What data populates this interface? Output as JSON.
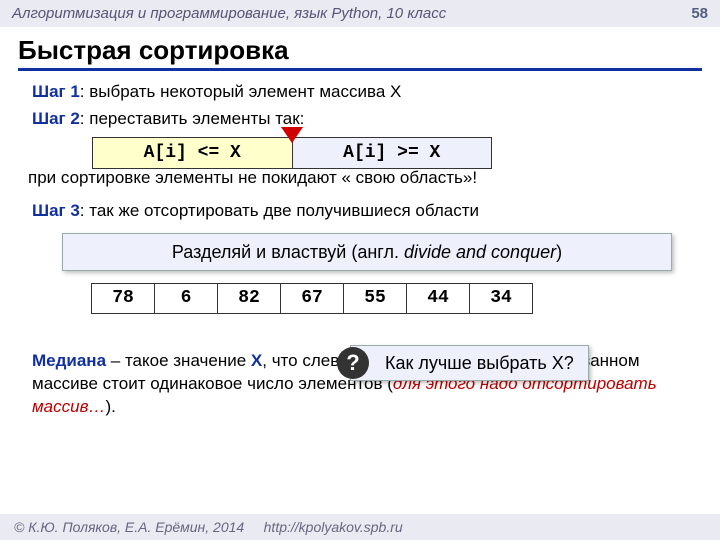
{
  "header": {
    "course": "Алгоритмизация и программирование, язык Python, 10 класс",
    "page": "58"
  },
  "title": "Быстрая сортировка",
  "step1": {
    "label": "Шаг 1",
    "text": ": выбрать некоторый элемент массива X"
  },
  "step2": {
    "label": "Шаг 2",
    "text": ": переставить элементы так:"
  },
  "split": {
    "left": "A[i] <= X",
    "right": "A[i] >= X"
  },
  "note_after_split": "при сортировке элементы не покидают « свою область»!",
  "step3": {
    "label": "Шаг 3",
    "text": ": так же отсортировать две получившиеся области"
  },
  "callout": {
    "ru": "Разделяй и властвуй (англ. ",
    "en": "divide and conquer",
    "tail": ")"
  },
  "array": [
    "78",
    "6",
    "82",
    "67",
    "55",
    "44",
    "34"
  ],
  "question": "Как лучше выбрать X?",
  "median": {
    "label": "Медиана",
    "body1": " – такое значение ",
    "x": "X",
    "body2": ", что слева и справа от него в отсортированном массиве стоит одинаковое число элементов (",
    "warn": "для этого надо отсортировать массив…",
    "tail": ")."
  },
  "footer": {
    "copyright": "© К.Ю. Поляков, Е.А. Ерёмин, 2014",
    "url": "http://kpolyakov.spb.ru"
  }
}
